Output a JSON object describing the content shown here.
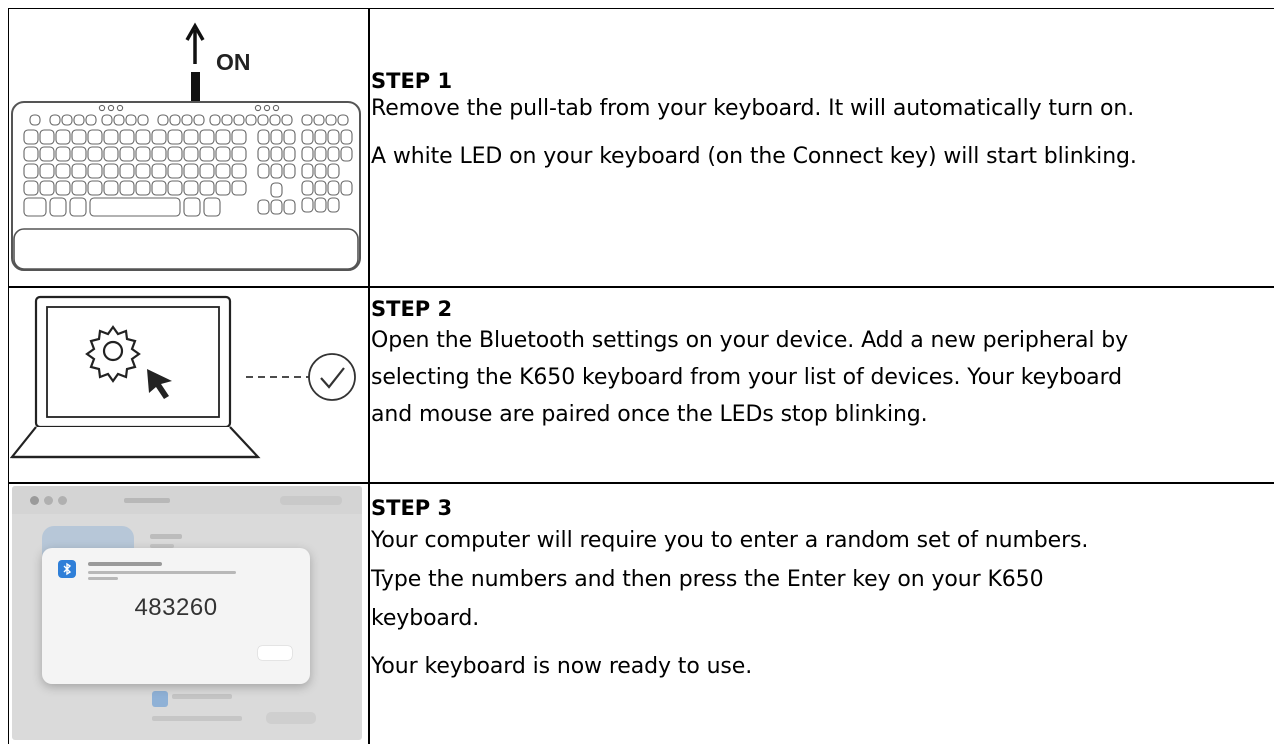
{
  "steps": [
    {
      "title": "STEP 1",
      "illustration": {
        "label": "ON",
        "icon": "keyboard-pull-tab-illustration"
      },
      "paragraphs": [
        "Remove the pull-tab from your keyboard. It will automatically turn on.",
        "A white LED on your keyboard (on the Connect key) will start blinking."
      ]
    },
    {
      "title": "STEP 2",
      "illustration": {
        "icon": "laptop-settings-check-illustration"
      },
      "lines": [
        "Open the Bluetooth settings on your device. Add a new peripheral by",
        "selecting the K650 keyboard from your list of devices. Your keyboard",
        "and mouse are paired once the LEDs stop blinking."
      ]
    },
    {
      "title": "STEP 3",
      "illustration": {
        "code": "483260",
        "icon": "pairing-dialog-screenshot"
      },
      "lines": [
        "Your computer will require you to enter a random set of numbers.",
        "Type the numbers and then press the Enter key on your K650",
        "keyboard."
      ],
      "final": "Your keyboard is now ready to use."
    }
  ]
}
